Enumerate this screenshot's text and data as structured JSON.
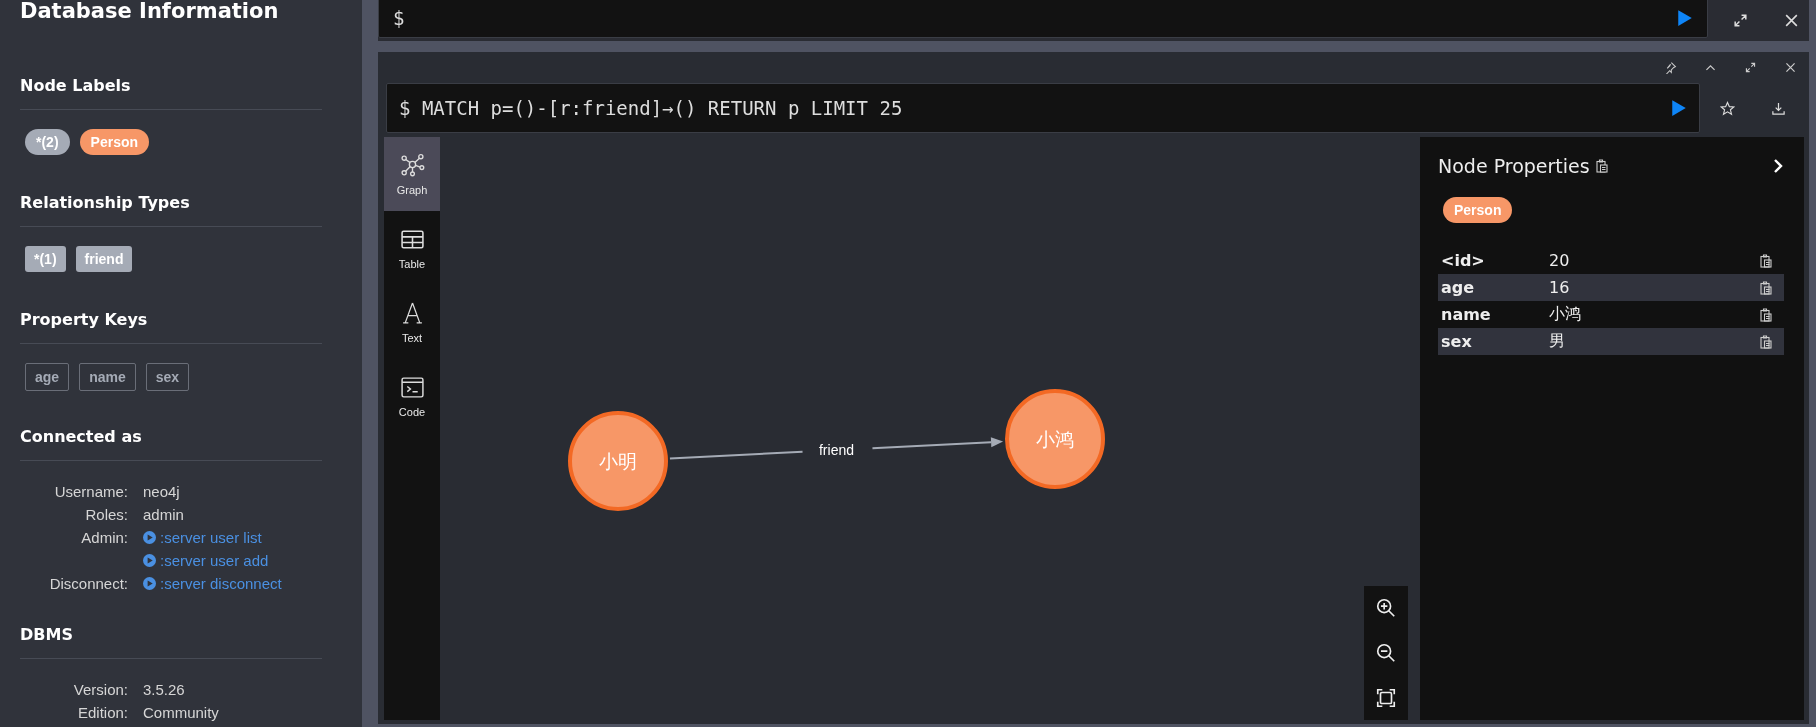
{
  "sidebar": {
    "title": "Database Information",
    "node_labels": {
      "heading": "Node Labels",
      "items": [
        {
          "label": "*(2)",
          "color": "#a5abb6"
        },
        {
          "label": "Person",
          "color": "#f79767"
        }
      ]
    },
    "relationship_types": {
      "heading": "Relationship Types",
      "items": [
        "*(1)",
        "friend"
      ]
    },
    "property_keys": {
      "heading": "Property Keys",
      "items": [
        "age",
        "name",
        "sex"
      ]
    },
    "connected_as": {
      "heading": "Connected as",
      "rows": [
        {
          "label": "Username:",
          "values": [
            {
              "kind": "text",
              "text": "neo4j"
            }
          ]
        },
        {
          "label": "Roles:",
          "values": [
            {
              "kind": "text",
              "text": "admin"
            }
          ]
        },
        {
          "label": "Admin:",
          "values": [
            {
              "kind": "link",
              "text": ":server user list"
            },
            {
              "kind": "link",
              "text": ":server user add"
            }
          ]
        },
        {
          "label": "Disconnect:",
          "values": [
            {
              "kind": "link",
              "text": ":server disconnect"
            }
          ]
        }
      ]
    },
    "dbms": {
      "heading": "DBMS",
      "rows": [
        {
          "label": "Version:",
          "values": [
            {
              "kind": "text",
              "text": "3.5.26"
            }
          ]
        },
        {
          "label": "Edition:",
          "values": [
            {
              "kind": "text",
              "text": "Community"
            }
          ]
        }
      ]
    }
  },
  "top_editor": {
    "prompt": "$"
  },
  "result_frame": {
    "query": {
      "prompt": "$",
      "text": "MATCH p=()-[r:friend]→() RETURN p LIMIT 25"
    },
    "views": [
      {
        "label": "Graph",
        "kind": "graph",
        "selected": true
      },
      {
        "label": "Table",
        "kind": "table",
        "selected": false
      },
      {
        "label": "Text",
        "kind": "text",
        "selected": false
      },
      {
        "label": "Code",
        "kind": "code",
        "selected": false
      }
    ],
    "graph": {
      "nodes": [
        {
          "label": "小明"
        },
        {
          "label": "小鸿"
        }
      ],
      "relationships": [
        {
          "label": "friend"
        }
      ]
    },
    "inspector": {
      "title": "Node Properties",
      "label": "Person",
      "properties": [
        {
          "key": "<id>",
          "value": "20"
        },
        {
          "key": "age",
          "value": "16"
        },
        {
          "key": "name",
          "value": "小鸿"
        },
        {
          "key": "sex",
          "value": "男"
        }
      ]
    }
  }
}
